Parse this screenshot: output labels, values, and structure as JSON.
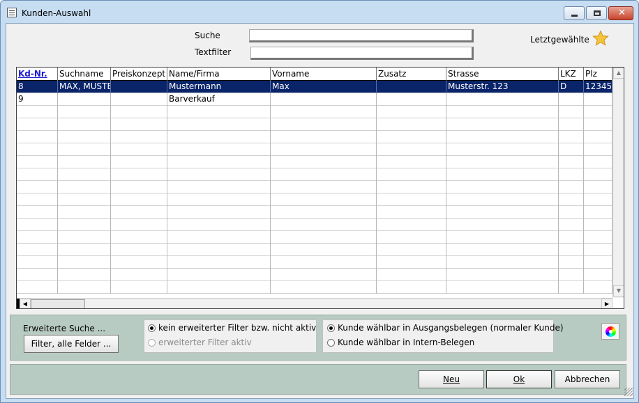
{
  "window": {
    "title": "Kunden-Auswahl"
  },
  "search": {
    "suche_label": "Suche",
    "suche_value": "",
    "textfilter_label": "Textfilter",
    "textfilter_value": "",
    "recent_label": "Letztgewählte",
    "recent_icon": "star-icon"
  },
  "table": {
    "columns": [
      "Kd-Nr.",
      "Suchname",
      "Preiskonzept",
      "Name/Firma",
      "Vorname",
      "Zusatz",
      "Strasse",
      "LKZ",
      "Plz"
    ],
    "rows": [
      {
        "cells": [
          "8",
          "MAX, MUSTERMANN",
          "",
          "Mustermann",
          "Max",
          "",
          "Musterstr. 123",
          "D",
          "12345"
        ],
        "selected": true
      },
      {
        "cells": [
          "9",
          "",
          "",
          "Barverkauf",
          "",
          "",
          "",
          "",
          ""
        ],
        "selected": false
      }
    ]
  },
  "filter": {
    "erweiterte_suche_label": "Erweiterte Suche ...",
    "filter_button": "Filter, alle Felder ...",
    "option_inactive": "kein erweiterter Filter bzw. nicht aktiv",
    "option_active": "erweiterter Filter aktiv",
    "selected": "inactive"
  },
  "customer_type": {
    "option_outgoing": "Kunde wählbar in Ausgangsbelegen (normaler Kunde)",
    "option_internal": "Kunde wählbar in Intern-Belegen",
    "selected": "outgoing"
  },
  "buttons": {
    "new": "Neu",
    "ok": "Ok",
    "cancel": "Abbrechen"
  },
  "colors": {
    "selection": "#0a246a",
    "header_link": "#1a1ad0",
    "panel": "#b8cbc2",
    "titlebar": "#c6ddf2"
  }
}
